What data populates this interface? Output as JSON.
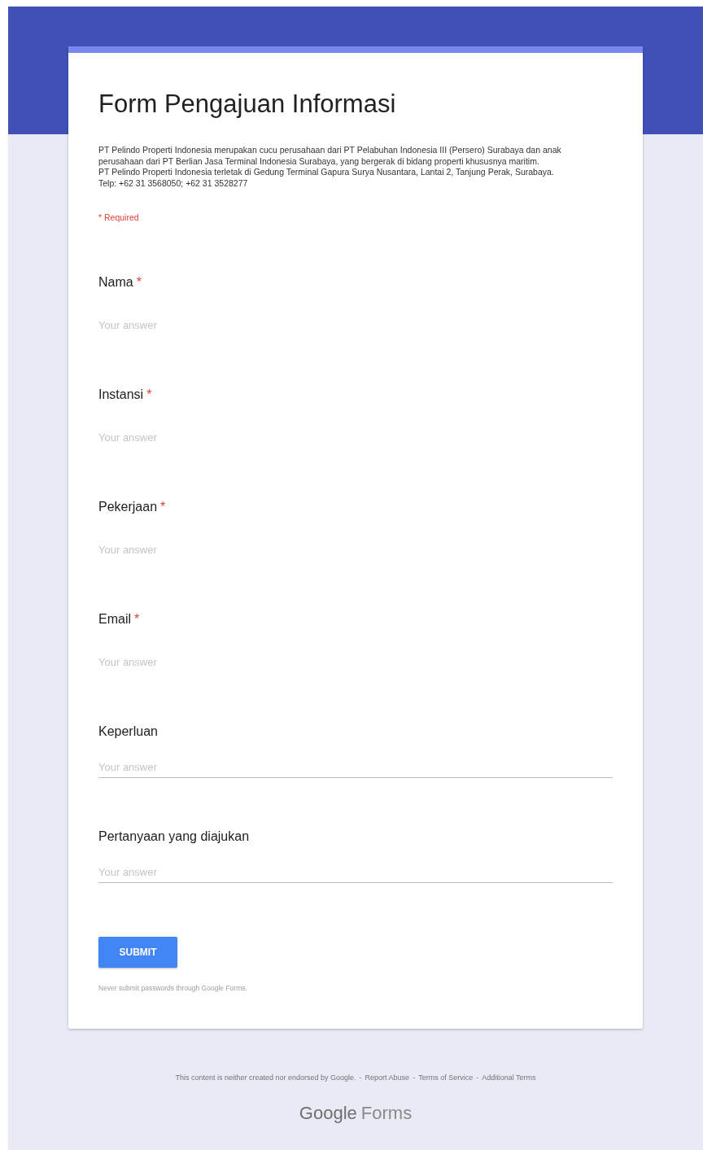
{
  "form": {
    "title": "Form Pengajuan Informasi",
    "description": "PT Pelindo Properti Indonesia merupakan cucu perusahaan dari PT Pelabuhan Indonesia III (Persero) Surabaya dan anak perusahaan dari PT Berlian Jasa Terminal Indonesia Surabaya, yang bergerak di bidang properti khususnya maritim.\nPT Pelindo Properti Indonesia terletak di Gedung Terminal Gapura Surya Nusantara, Lantai 2, Tanjung Perak, Surabaya.\nTelp: +62 31 3568050; +62 31 3528277",
    "required_note": "* Required",
    "fields": [
      {
        "label": "Nama",
        "required_mark": "*",
        "placeholder": "Your answer",
        "underlined": false
      },
      {
        "label": "Instansi",
        "required_mark": "*",
        "placeholder": "Your answer",
        "underlined": false
      },
      {
        "label": "Pekerjaan",
        "required_mark": "*",
        "placeholder": "Your answer",
        "underlined": false
      },
      {
        "label": "Email",
        "required_mark": "*",
        "placeholder": "Your answer",
        "underlined": false
      },
      {
        "label": "Keperluan",
        "placeholder": "Your answer",
        "underlined": true
      },
      {
        "label": "Pertanyaan yang diajukan",
        "placeholder": "Your answer",
        "underlined": true
      }
    ],
    "submit": "SUBMIT",
    "password_note": "Never submit passwords through Google Forms."
  },
  "footer": {
    "text": "This content is neither created nor endorsed by Google.",
    "links": [
      "Report Abuse",
      "Terms of Service",
      "Additional Terms"
    ],
    "separator": "-"
  },
  "logo": {
    "brand": "Google",
    "product": "Forms"
  }
}
